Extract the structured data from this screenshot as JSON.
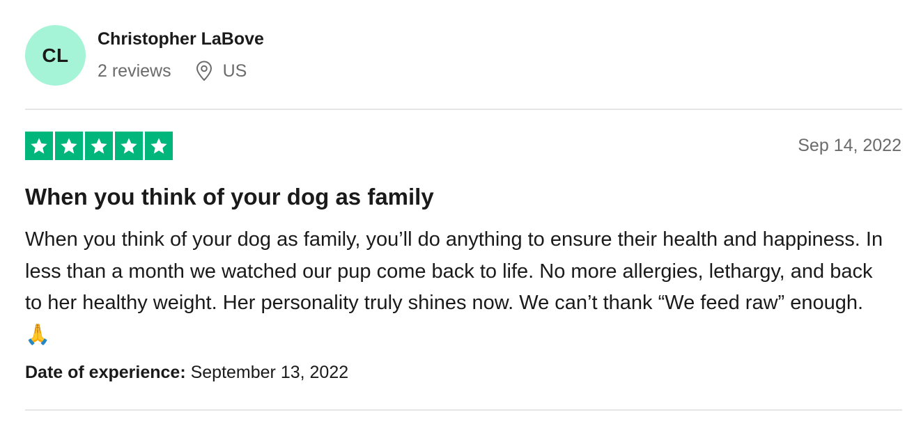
{
  "reviewer": {
    "initials": "CL",
    "avatar_color": "#a6f4d7",
    "name": "Christopher LaBove",
    "review_count": "2 reviews",
    "location_icon": "location-pin-icon",
    "location": "US"
  },
  "review": {
    "rating": 5,
    "rating_max": 5,
    "star_color": "#00b67a",
    "date": "Sep 14, 2022",
    "title": "When you think of your dog as family",
    "body": "When you think of your dog as family, you’ll do anything to ensure their health and happiness. In less than a month we watched our pup come back to life. No more allergies, lethargy, and back to her healthy weight. Her personality truly shines now. We can’t thank “We feed raw” enough. 🙏",
    "experience_label": "Date of experience:",
    "experience_date": "September 13, 2022"
  }
}
